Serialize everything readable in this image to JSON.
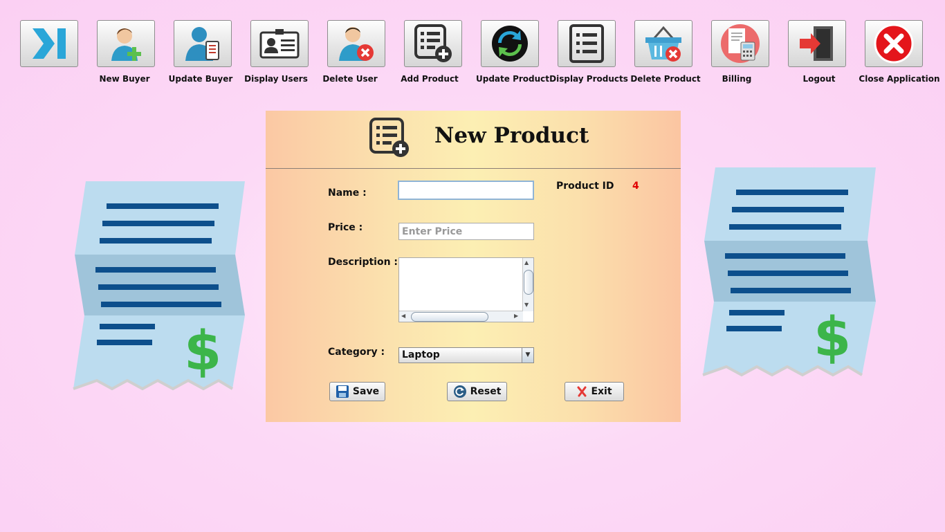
{
  "toolbar": {
    "items": [
      {
        "label": "",
        "icon": "collapse-icon"
      },
      {
        "label": "New Buyer",
        "icon": "new-buyer-icon"
      },
      {
        "label": "Update Buyer",
        "icon": "update-buyer-icon"
      },
      {
        "label": "Display Users",
        "icon": "id-card-icon"
      },
      {
        "label": "Delete User",
        "icon": "delete-user-icon"
      },
      {
        "label": "Add Product",
        "icon": "add-list-icon"
      },
      {
        "label": "Update Product",
        "icon": "refresh-icon"
      },
      {
        "label": "Display Products",
        "icon": "list-icon"
      },
      {
        "label": "Delete Product",
        "icon": "basket-delete-icon"
      },
      {
        "label": "Billing",
        "icon": "billing-icon"
      },
      {
        "label": "Logout",
        "icon": "logout-icon"
      },
      {
        "label": "Close Application",
        "icon": "close-icon"
      }
    ]
  },
  "form": {
    "title": "New Product",
    "name_label": "Name :",
    "name_value": "",
    "price_label": "Price :",
    "price_placeholder": "Enter Price",
    "description_label": "Description :",
    "description_value": "",
    "category_label": "Category :",
    "category_value": "Laptop",
    "product_id_label": "Product ID",
    "product_id_value": "4",
    "save_label": "Save",
    "reset_label": "Reset",
    "exit_label": "Exit"
  },
  "colors": {
    "background": "#fbd0f3",
    "product_id": "#e00000",
    "receipt": "#b8d8ec",
    "receipt_lines": "#0d4f8c",
    "dollar": "#3cb54a"
  }
}
